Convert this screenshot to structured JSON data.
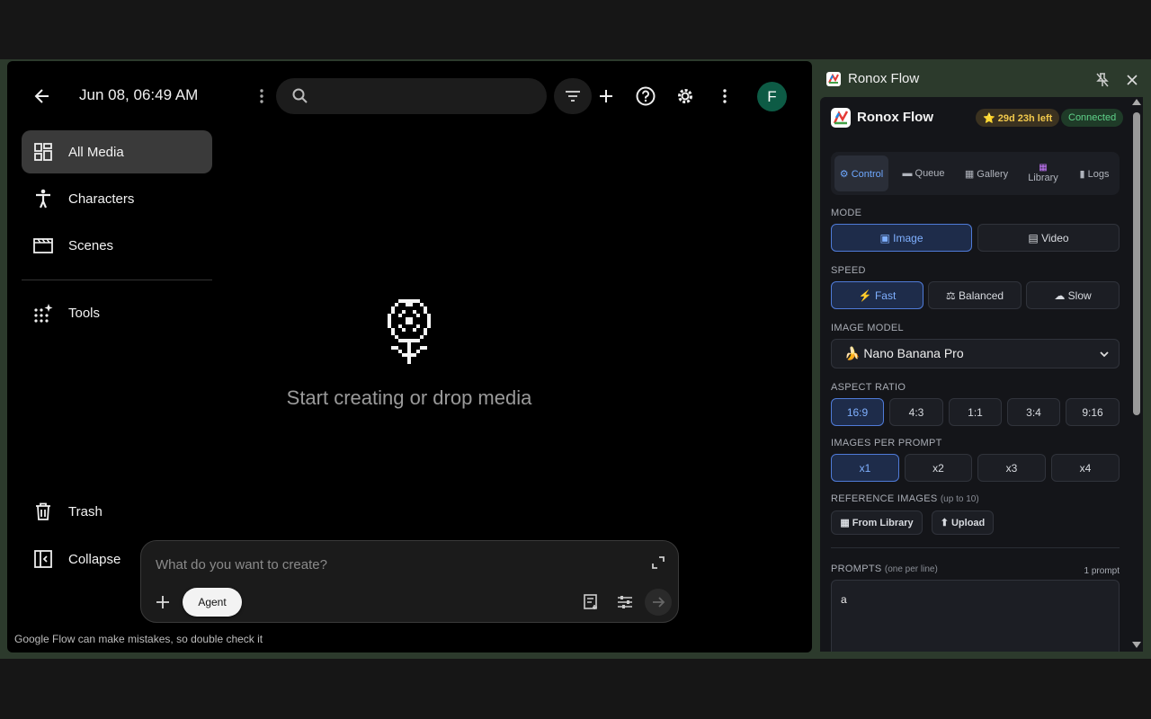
{
  "flow": {
    "project_title": "Jun 08, 06:49 AM",
    "search_placeholder": "",
    "avatar_letter": "F",
    "nav": [
      {
        "label": "All Media",
        "icon": "grid-icon"
      },
      {
        "label": "Characters",
        "icon": "person-icon"
      },
      {
        "label": "Scenes",
        "icon": "clapperboard-icon"
      },
      {
        "label": "Tools",
        "icon": "sparkle-grid-icon"
      },
      {
        "label": "Trash",
        "icon": "trash-icon"
      },
      {
        "label": "Collapse",
        "icon": "collapse-panel-icon"
      }
    ],
    "empty_state_text": "Start creating or drop media",
    "composer_placeholder": "What do you want to create?",
    "agent_label": "Agent",
    "disclaimer": "Google Flow can make mistakes, so double check it"
  },
  "side": {
    "window_title": "Ronox Flow",
    "brand": "Ronox Flow",
    "time_left": "⭐ 29d 23h left",
    "status": "Connected",
    "tabs": [
      {
        "label": "⚙ Control",
        "active": true
      },
      {
        "label": "▬ Queue"
      },
      {
        "label": "▦ Gallery"
      },
      {
        "label": "Library",
        "icon": "▦"
      },
      {
        "label": "▮ Logs"
      }
    ],
    "mode_label": "MODE",
    "mode_options": [
      {
        "label": "▣ Image",
        "selected": true
      },
      {
        "label": "▤ Video"
      }
    ],
    "speed_label": "SPEED",
    "speed_options": [
      {
        "label": "⚡ Fast",
        "selected": true
      },
      {
        "label": "⚖ Balanced"
      },
      {
        "label": "☁ Slow"
      }
    ],
    "model_label": "IMAGE MODEL",
    "model_value": "🍌 Nano Banana Pro",
    "aspect_label": "ASPECT RATIO",
    "aspect_options": [
      "16:9",
      "4:3",
      "1:1",
      "3:4",
      "9:16"
    ],
    "aspect_selected": "16:9",
    "images_label": "IMAGES PER PROMPT",
    "images_options": [
      "x1",
      "x2",
      "x3",
      "x4"
    ],
    "images_selected": "x1",
    "ref_label": "REFERENCE IMAGES",
    "ref_hint": "(up to 10)",
    "ref_buttons": [
      "▦ From Library",
      "⬆ Upload"
    ],
    "prompts_label": "PROMPTS",
    "prompts_hint": "(one per line)",
    "prompt_count": "1 prompt",
    "prompt_text": "a"
  },
  "colors": {
    "accent": "#6ea8ff",
    "selected_bg": "#1e2c4a",
    "connected": "#5fd38a",
    "time_badge": "#f2c94c",
    "avatar": "#0d5b45"
  }
}
